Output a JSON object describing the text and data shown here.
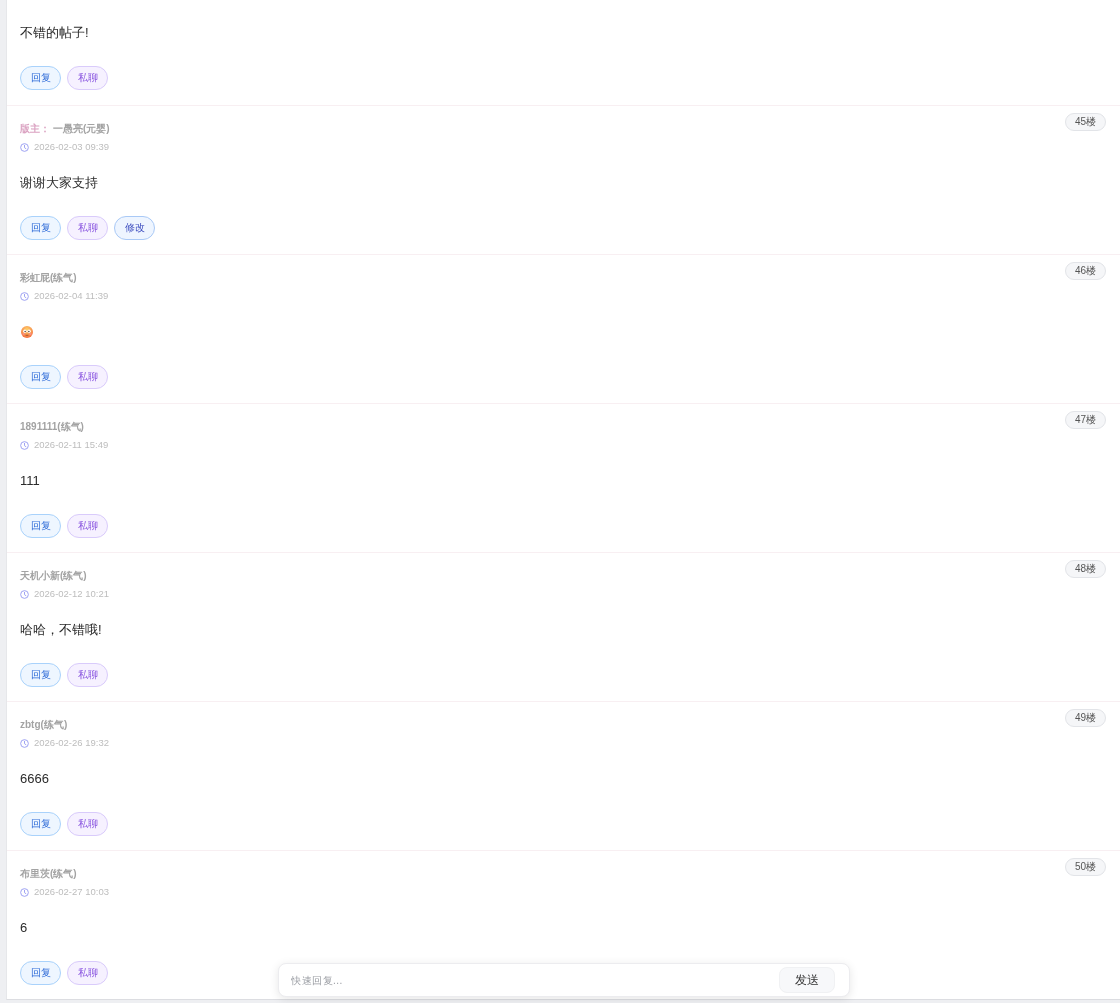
{
  "posts": [
    {
      "content": {
        "kind": "text",
        "text": "不错的帖子!"
      },
      "actions": [
        {
          "kind": "reply",
          "label": "回复"
        },
        {
          "kind": "chat",
          "label": "私聊"
        }
      ]
    },
    {
      "floor": "45楼",
      "role": "版主：",
      "author": "一愚亮(元婴)",
      "time": "2026-02-03 09:39",
      "content": {
        "kind": "text",
        "text": "谢谢大家支持"
      },
      "actions": [
        {
          "kind": "reply",
          "label": "回复"
        },
        {
          "kind": "chat",
          "label": "私聊"
        },
        {
          "kind": "edit",
          "label": "修改"
        }
      ]
    },
    {
      "floor": "46楼",
      "author": "彩虹屁(练气)",
      "time": "2026-02-04 11:39",
      "content": {
        "kind": "emoji"
      },
      "actions": [
        {
          "kind": "reply",
          "label": "回复"
        },
        {
          "kind": "chat",
          "label": "私聊"
        }
      ]
    },
    {
      "floor": "47楼",
      "author": "1891111(练气)",
      "time": "2026-02-11 15:49",
      "content": {
        "kind": "text",
        "text": "111"
      },
      "actions": [
        {
          "kind": "reply",
          "label": "回复"
        },
        {
          "kind": "chat",
          "label": "私聊"
        }
      ]
    },
    {
      "floor": "48楼",
      "author": "天机小新(练气)",
      "time": "2026-02-12 10:21",
      "content": {
        "kind": "text",
        "text": "哈哈，不错哦!"
      },
      "actions": [
        {
          "kind": "reply",
          "label": "回复"
        },
        {
          "kind": "chat",
          "label": "私聊"
        }
      ]
    },
    {
      "floor": "49楼",
      "author": "zbtg(练气)",
      "time": "2026-02-26 19:32",
      "content": {
        "kind": "text",
        "text": "6666"
      },
      "actions": [
        {
          "kind": "reply",
          "label": "回复"
        },
        {
          "kind": "chat",
          "label": "私聊"
        }
      ]
    },
    {
      "floor": "50楼",
      "author": "布里茨(练气)",
      "time": "2026-02-27 10:03",
      "content": {
        "kind": "text",
        "text": "6"
      },
      "actions": [
        {
          "kind": "reply",
          "label": "回复"
        },
        {
          "kind": "chat",
          "label": "私聊"
        }
      ]
    }
  ],
  "quick_reply": {
    "placeholder": "快速回复...",
    "button": "发送"
  }
}
